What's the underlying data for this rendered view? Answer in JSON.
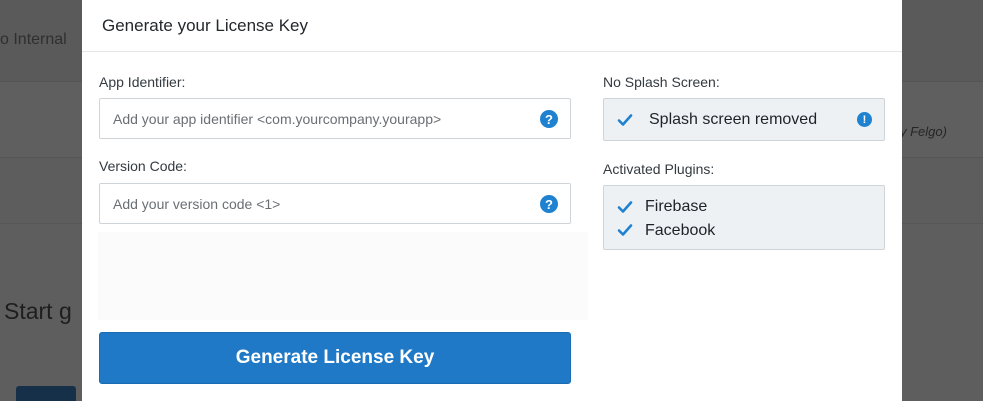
{
  "background": {
    "tab_fragment": "o Internal",
    "note_fragment": "y Felgo)",
    "heading_fragment": "Start g"
  },
  "modal": {
    "title": "Generate your License Key",
    "app_identifier": {
      "label": "App Identifier:",
      "placeholder": "Add your app identifier <com.yourcompany.yourapp>",
      "help_icon": "question-circle-icon",
      "help_glyph": "?"
    },
    "version_code": {
      "label": "Version Code:",
      "placeholder": "Add your version code <1>",
      "help_icon": "question-circle-icon",
      "help_glyph": "?"
    },
    "no_splash": {
      "label": "No Splash Screen:",
      "status": "Splash screen removed",
      "status_icon": "checkmark-icon",
      "info_icon": "exclamation-circle-icon",
      "info_glyph": "!"
    },
    "plugins": {
      "label": "Activated Plugins:",
      "items": [
        "Firebase",
        "Facebook"
      ]
    },
    "generate_button": "Generate License Key"
  },
  "colors": {
    "accent": "#1f79c6",
    "icon_blue": "#1f82d0",
    "overlay": "#5e5e5e",
    "box_bg": "#eef1f4"
  }
}
